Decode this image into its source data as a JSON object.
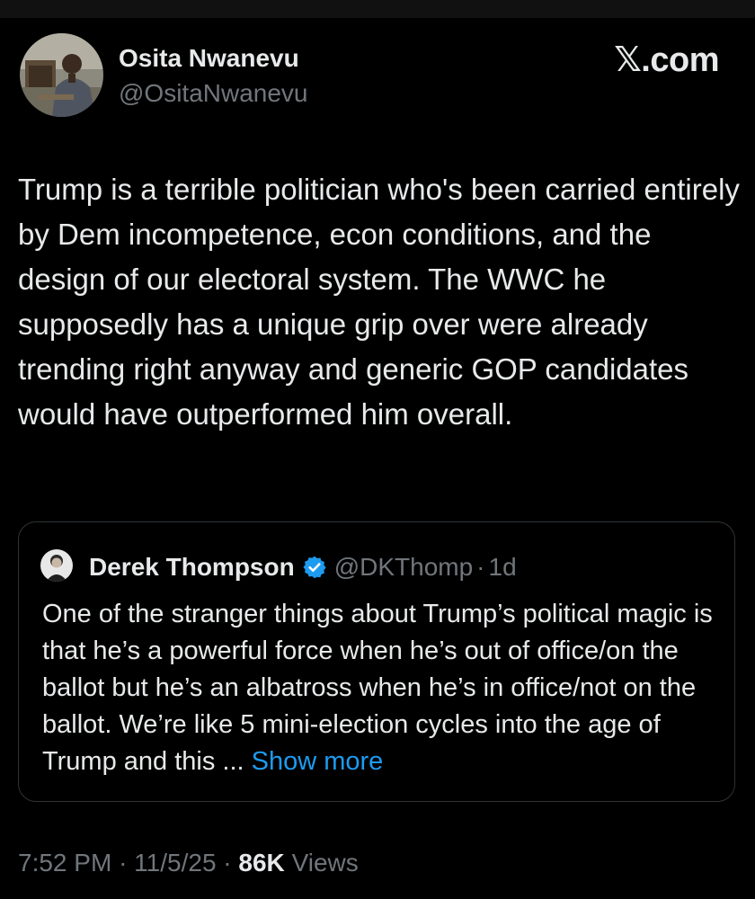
{
  "author": {
    "name": "Osita Nwanevu",
    "handle": "@OsitaNwanevu",
    "avatar_icon": "person-photo-avatar"
  },
  "brand": {
    "label": "𝕏.com"
  },
  "tweet": {
    "text": "Trump is a terrible politician who's been carried entirely by Dem incompetence, econ conditions, and the design of our electoral system. The WWC he supposedly has a unique grip over were already trending right anyway and generic GOP candidates would have outperformed him overall."
  },
  "quote": {
    "name": "Derek Thompson",
    "verified_icon": "verified-badge-icon",
    "handle": "@DKThomp",
    "separator": "·",
    "time": "1d",
    "text": "One of the stranger things about Trump’s political magic is that he’s a powerful force when he’s out of office/on the ballot but he’s an albatross when he’s in office/not on the ballot. We’re like 5 mini-election cycles into the age of Trump and this ...",
    "show_more": "Show more"
  },
  "meta": {
    "time": "7:52 PM",
    "separator": "·",
    "date": "11/5/25",
    "views_count": "86K",
    "views_label": "Views"
  },
  "colors": {
    "background": "#000000",
    "text_primary": "#e7e9ea",
    "text_secondary": "#71767b",
    "link": "#1d9bf0",
    "border": "#2f3336"
  }
}
